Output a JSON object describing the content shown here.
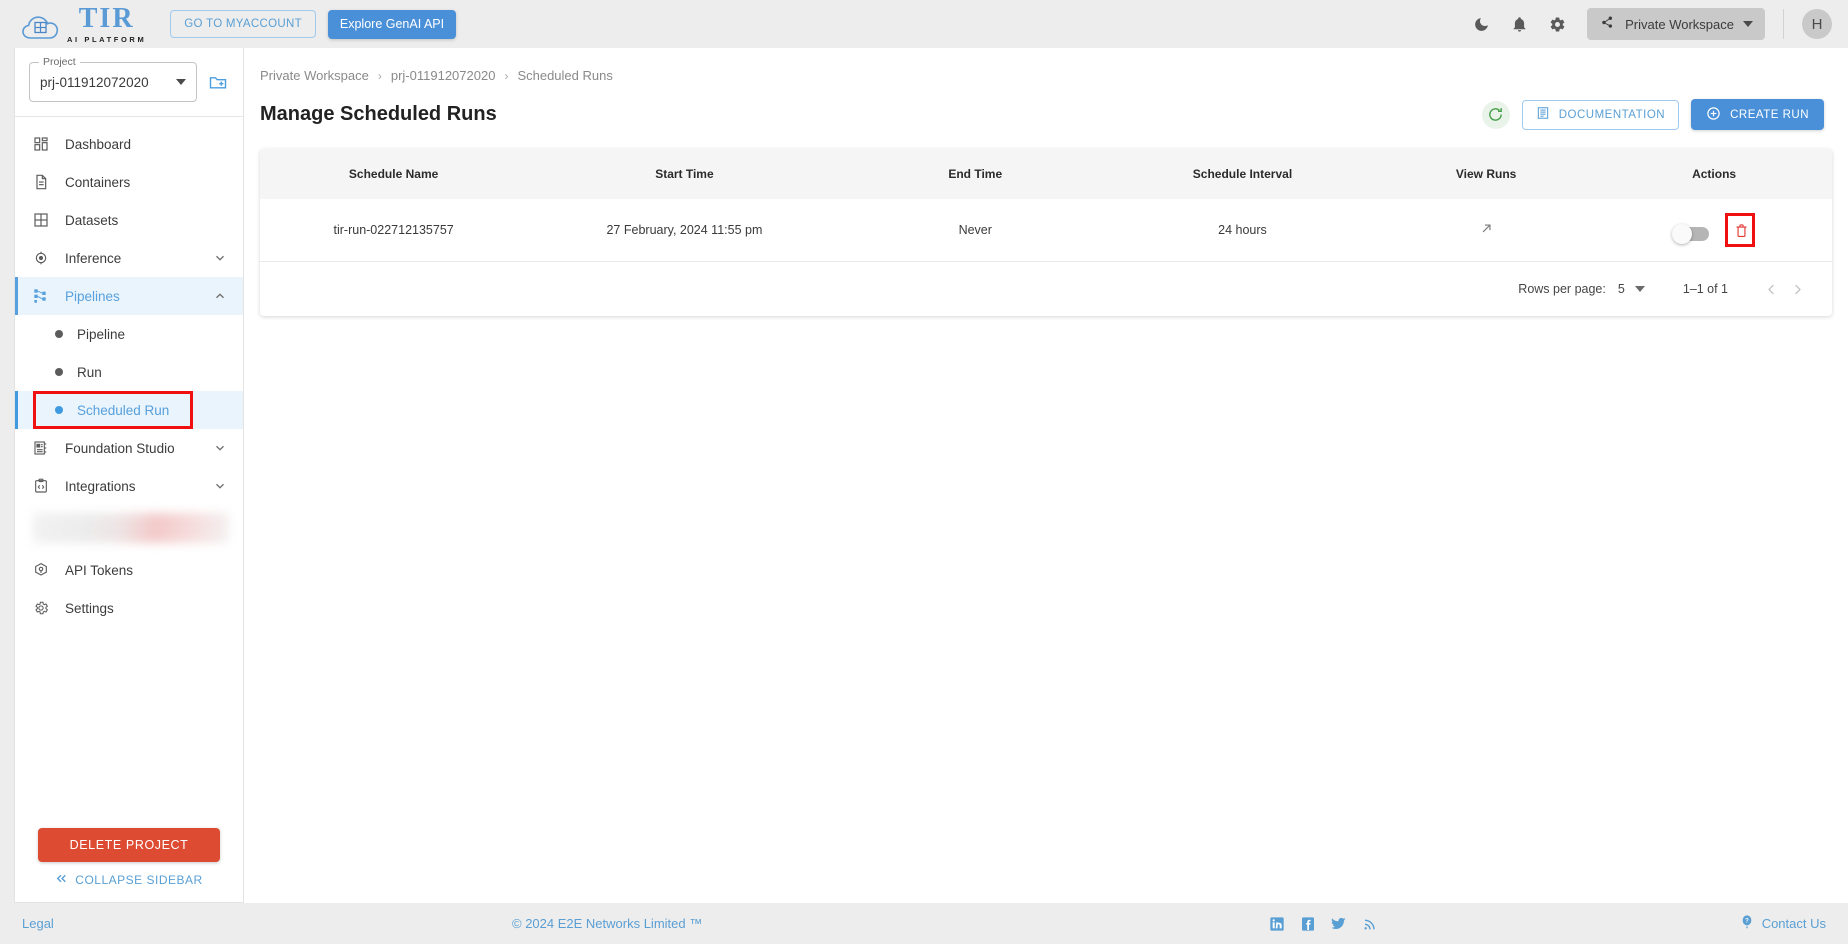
{
  "header": {
    "logo_main": "TIR",
    "logo_sub": "AI PLATFORM",
    "logo_cloud_label": "E2E Cloud",
    "myaccount_button": "GO TO MYACCOUNT",
    "genai_button": "Explore GenAI API",
    "dark_mode_icon": "moon-icon",
    "notifications_icon": "bell-icon",
    "settings_icon": "gear-icon",
    "workspace": "Private Workspace",
    "avatar_initial": "H"
  },
  "sidebar": {
    "project_legend": "Project",
    "project_value": "prj-011912072020",
    "new_project_icon": "new-folder-icon",
    "items": [
      {
        "label": "Dashboard",
        "icon": "dashboard-icon",
        "type": "item",
        "expandable": false,
        "active": false
      },
      {
        "label": "Containers",
        "icon": "document-icon",
        "type": "item",
        "expandable": false,
        "active": false
      },
      {
        "label": "Datasets",
        "icon": "grid-icon",
        "type": "item",
        "expandable": false,
        "active": false
      },
      {
        "label": "Inference",
        "icon": "inference-icon",
        "type": "item",
        "expandable": true,
        "expanded": false,
        "active": false
      },
      {
        "label": "Pipelines",
        "icon": "pipelines-icon",
        "type": "item",
        "expandable": true,
        "expanded": true,
        "active": true
      },
      {
        "label": "Pipeline",
        "type": "sub",
        "active": false
      },
      {
        "label": "Run",
        "type": "sub",
        "active": false
      },
      {
        "label": "Scheduled Run",
        "type": "sub",
        "active": true,
        "highlighted": true
      },
      {
        "label": "Foundation Studio",
        "icon": "foundation-studio-icon",
        "type": "item",
        "expandable": true,
        "expanded": false,
        "active": false
      },
      {
        "label": "Integrations",
        "icon": "code-clipboard-icon",
        "type": "item",
        "expandable": true,
        "expanded": false,
        "active": false
      },
      {
        "label": "",
        "type": "blurred",
        "active": false
      },
      {
        "label": "API Tokens",
        "icon": "token-icon",
        "type": "item",
        "expandable": false,
        "active": false
      },
      {
        "label": "Settings",
        "icon": "gear-icon",
        "type": "item",
        "expandable": false,
        "active": false
      }
    ],
    "delete_project_button": "DELETE PROJECT",
    "collapse_label": "COLLAPSE SIDEBAR",
    "collapse_icon": "chevron-double-left-icon"
  },
  "breadcrumb": {
    "items": [
      "Private Workspace",
      "prj-011912072020",
      "Scheduled Runs"
    ],
    "separator": "›"
  },
  "page": {
    "title": "Manage Scheduled Runs",
    "refresh_icon": "refresh-icon",
    "documentation_button": "DOCUMENTATION",
    "documentation_icon": "book-icon",
    "create_run_button": "CREATE RUN",
    "create_run_icon": "plus-circle-icon"
  },
  "table": {
    "columns": [
      "Schedule Name",
      "Start Time",
      "End Time",
      "Schedule Interval",
      "View Runs",
      "Actions"
    ],
    "rows": [
      {
        "schedule_name": "tir-run-022712135757",
        "start_time": "27 February, 2024 11:55 pm",
        "end_time": "Never",
        "schedule_interval": "24 hours",
        "view_runs_icon": "arrow-up-right-icon",
        "enabled": false,
        "delete_icon": "trash-icon",
        "delete_highlighted": true
      }
    ]
  },
  "pagination": {
    "rows_per_page_label": "Rows per page:",
    "rows_per_page_value": "5",
    "range_label": "1–1 of 1",
    "prev_icon": "chevron-left-icon",
    "next_icon": "chevron-right-icon"
  },
  "footer": {
    "legal": "Legal",
    "copyright": "© 2024 E2E Networks Limited ™",
    "socials": [
      "linkedin-icon",
      "facebook-icon",
      "twitter-icon",
      "rss-icon"
    ],
    "contact": "Contact Us",
    "contact_icon": "help-balloon-icon"
  },
  "colors": {
    "accent_blue": "#4a90d9",
    "link_blue": "#5a9fd4",
    "active_bg": "#eaf4fc",
    "danger_red": "#dd4b32",
    "delete_red": "#e3342f",
    "highlight_red": "#f01010",
    "page_bg": "#ededed"
  }
}
